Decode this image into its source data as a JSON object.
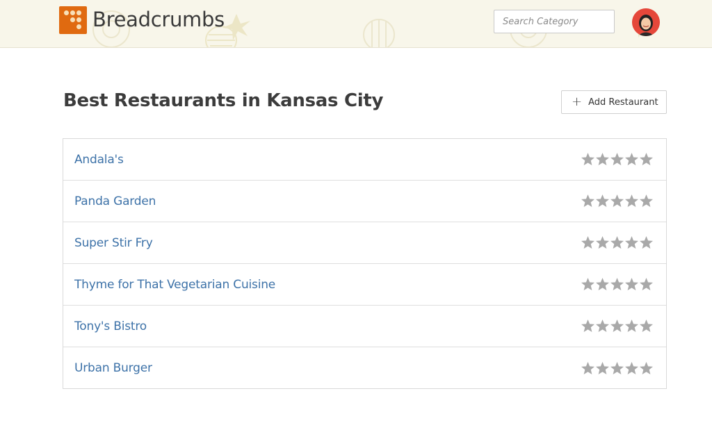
{
  "header": {
    "brand": "Breadcrumbs",
    "search": {
      "placeholder": "Search Category",
      "value": ""
    },
    "avatar_icon": "user-avatar"
  },
  "main": {
    "title": "Best Restaurants in Kansas City",
    "add_button": {
      "icon": "plus-icon",
      "label": "Add Restaurant"
    },
    "restaurants": [
      {
        "name": "Andala's",
        "rating": 0,
        "max_rating": 5
      },
      {
        "name": "Panda Garden",
        "rating": 0,
        "max_rating": 5
      },
      {
        "name": "Super Stir Fry",
        "rating": 0,
        "max_rating": 5
      },
      {
        "name": "Thyme for That Vegetarian Cuisine",
        "rating": 0,
        "max_rating": 5
      },
      {
        "name": "Tony's Bistro",
        "rating": 0,
        "max_rating": 5
      },
      {
        "name": "Urban Burger",
        "rating": 0,
        "max_rating": 5
      }
    ]
  },
  "colors": {
    "header_bg": "#f8f6ea",
    "brand_orange": "#e06a10",
    "link_blue": "#3d72a8",
    "star_empty": "#a9a9a9"
  }
}
